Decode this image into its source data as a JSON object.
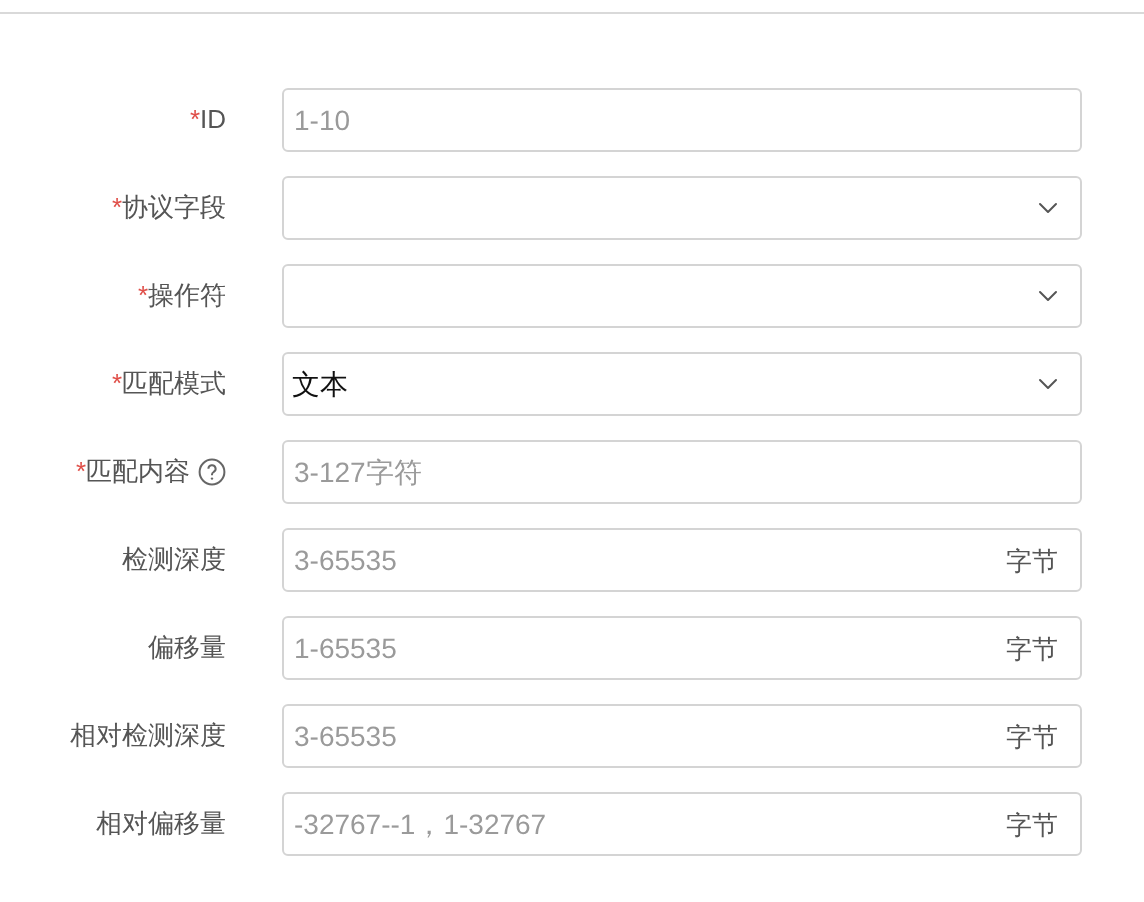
{
  "fields": [
    {
      "label": "ID",
      "required_mark": "*",
      "kind": "input",
      "placeholder": "1-10"
    },
    {
      "label": "协议字段",
      "required_mark": "*",
      "kind": "select"
    },
    {
      "label": "操作符",
      "required_mark": "*",
      "kind": "select"
    },
    {
      "label": "匹配模式",
      "required_mark": "*",
      "kind": "select",
      "value": "文本"
    },
    {
      "label": "匹配内容",
      "required_mark": "*",
      "help": true,
      "kind": "input",
      "placeholder": "3-127字符"
    },
    {
      "label": "检测深度",
      "kind": "input",
      "placeholder": "3-65535",
      "suffix": "字节"
    },
    {
      "label": "偏移量",
      "kind": "input",
      "placeholder": "1-65535",
      "suffix": "字节"
    },
    {
      "label": "相对检测深度",
      "kind": "input",
      "placeholder": "3-65535",
      "suffix": "字节"
    },
    {
      "label": "相对偏移量",
      "kind": "input",
      "placeholder": "-32767--1，1-32767",
      "suffix": "字节"
    }
  ]
}
